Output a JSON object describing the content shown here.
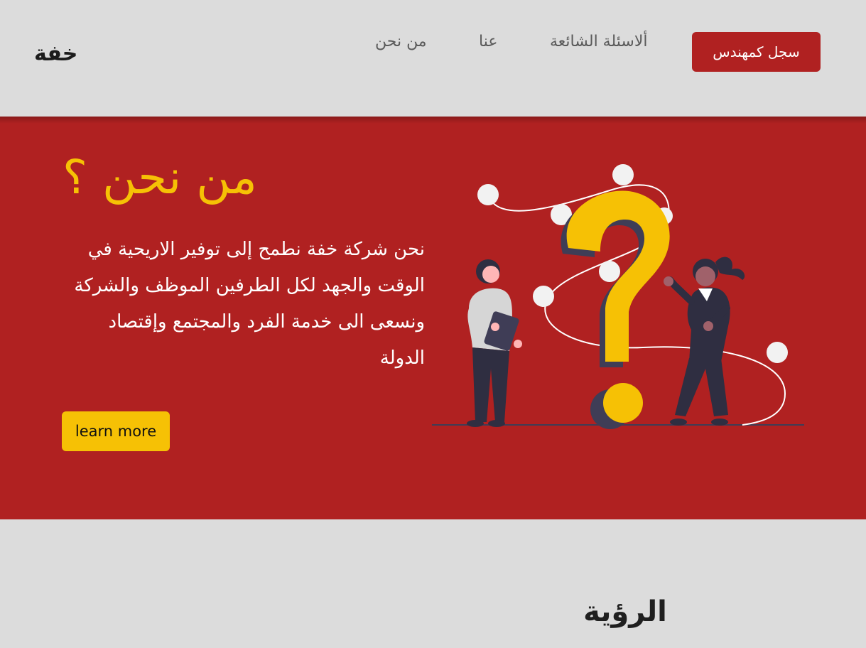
{
  "navbar": {
    "brand": "خفة",
    "links": [
      {
        "label": "من نحن"
      },
      {
        "label": "عنا"
      },
      {
        "label": "ألاسئلة الشائعة"
      }
    ],
    "register_label": "سجل كمهندس"
  },
  "hero": {
    "title": "من نحن ؟",
    "text": "نحن شركة خفة نطمح إلى توفير الاريحية في الوقت والجهد لكل الطرفين الموظف والشركة ونسعى الى خدمة الفرد والمجتمع وإقتصاد الدولة",
    "learn_more_label": "learn more"
  },
  "vision": {
    "title": "الرؤية"
  },
  "colors": {
    "primary_red": "#b02121",
    "accent_yellow": "#f6c105",
    "background_gray": "#dcdcdc"
  },
  "icons": {
    "illustration": "question-mark-illustration"
  }
}
